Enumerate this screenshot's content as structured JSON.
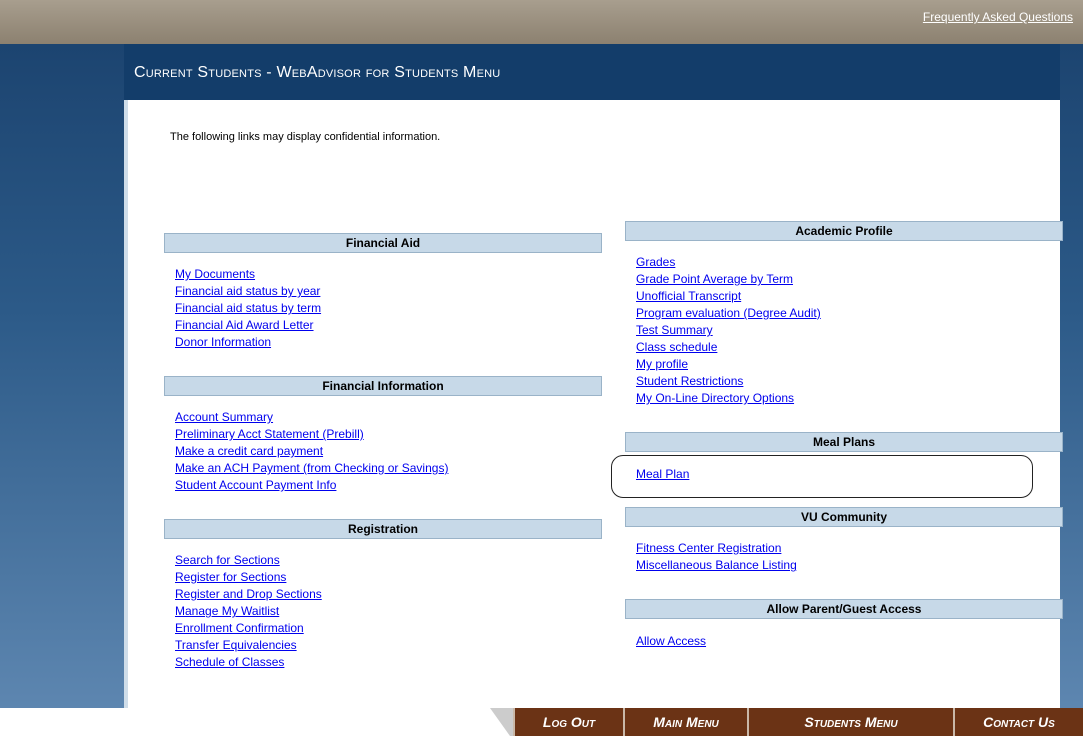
{
  "top": {
    "faq_label": "Frequently Asked Questions"
  },
  "header": {
    "title": "Current Students - WebAdvisor for Students Menu"
  },
  "notice": "The following links may display confidential information.",
  "left_panels": [
    {
      "title": "Financial Aid",
      "links": [
        "My Documents",
        "Financial aid status by year",
        "Financial aid status by term",
        "Financial Aid Award Letter",
        "Donor Information"
      ]
    },
    {
      "title": "Financial Information",
      "links": [
        "Account Summary",
        "Preliminary Acct Statement (Prebill)",
        "Make a credit card payment",
        "Make an ACH Payment (from Checking or Savings)",
        "Student Account Payment Info"
      ]
    },
    {
      "title": "Registration",
      "links": [
        "Search for Sections",
        "Register for Sections",
        "Register and Drop Sections",
        "Manage My Waitlist",
        "Enrollment Confirmation",
        "Transfer Equivalencies",
        "Schedule of Classes"
      ]
    }
  ],
  "right_panels": [
    {
      "title": "Academic Profile",
      "links": [
        "Grades",
        "Grade Point Average by Term",
        "Unofficial Transcript",
        "Program evaluation (Degree Audit)",
        "Test Summary",
        "Class schedule",
        "My profile",
        "Student Restrictions",
        "My On-Line Directory Options"
      ]
    },
    {
      "title": "Meal Plans",
      "links": [
        "Meal Plan"
      ]
    },
    {
      "title": "VU Community",
      "links": [
        "Fitness Center Registration",
        "Miscellaneous Balance Listing"
      ]
    },
    {
      "title": "Allow Parent/Guest Access",
      "links": [
        "Allow Access"
      ]
    }
  ],
  "nav": {
    "logout": "Log Out",
    "main_menu": "Main Menu",
    "students_menu": "Students Menu",
    "contact_us": "Contact Us"
  }
}
